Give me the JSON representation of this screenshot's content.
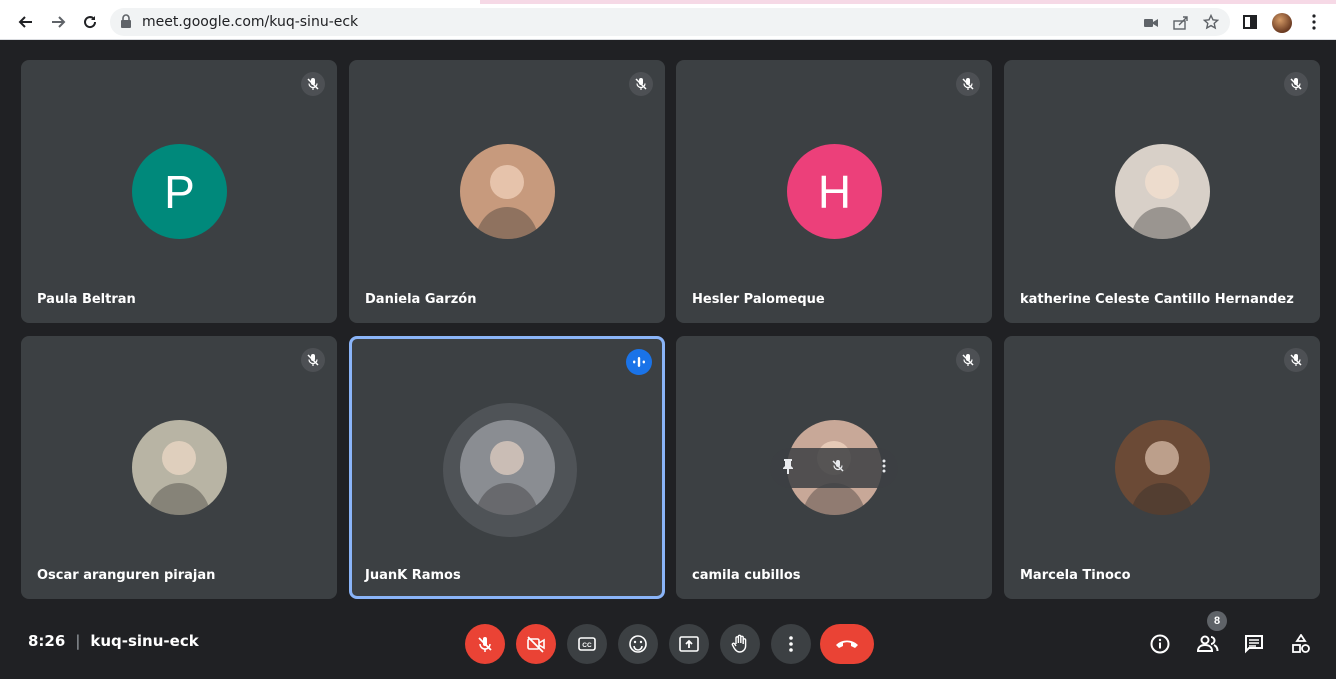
{
  "browser": {
    "url": "meet.google.com/kuq-sinu-eck",
    "icons": [
      "back-icon",
      "forward-icon",
      "reload-icon",
      "lock-icon",
      "camera-blocked-icon",
      "share-icon",
      "star-icon",
      "sidepanel-icon",
      "profile-avatar",
      "more-vert-icon"
    ]
  },
  "participants": [
    {
      "name": "Paula Beltran",
      "initial": "P",
      "avatar_color": "#00897b",
      "muted": true
    },
    {
      "name": "Daniela Garzón",
      "initial": "",
      "avatar_color": "#c79a7d",
      "muted": true
    },
    {
      "name": "Hesler Palomeque",
      "initial": "H",
      "avatar_color": "#ec407a",
      "muted": true
    },
    {
      "name": "katherine Celeste Cantillo Hernandez",
      "initial": "",
      "avatar_color": "#d8d0c8",
      "muted": true
    },
    {
      "name": "Oscar aranguren pirajan",
      "initial": "",
      "avatar_color": "#b8b4a4",
      "muted": true
    },
    {
      "name": "JuanK Ramos",
      "initial": "",
      "avatar_color": "#8a8d92",
      "muted": false,
      "speaking": true
    },
    {
      "name": "camila cubillos",
      "initial": "",
      "avatar_color": "#c8a898",
      "muted": true
    },
    {
      "name": "Marcela Tinoco",
      "initial": "",
      "avatar_color": "#6b4a36",
      "muted": true
    }
  ],
  "bottom_bar": {
    "time": "8:26",
    "meeting_code": "kuq-sinu-eck",
    "participant_count": "8"
  },
  "colors": {
    "background": "#202124",
    "tile": "#3c4043",
    "danger": "#ea4335",
    "active_border": "#8ab4f8",
    "speaking_badge": "#1a73e8"
  }
}
